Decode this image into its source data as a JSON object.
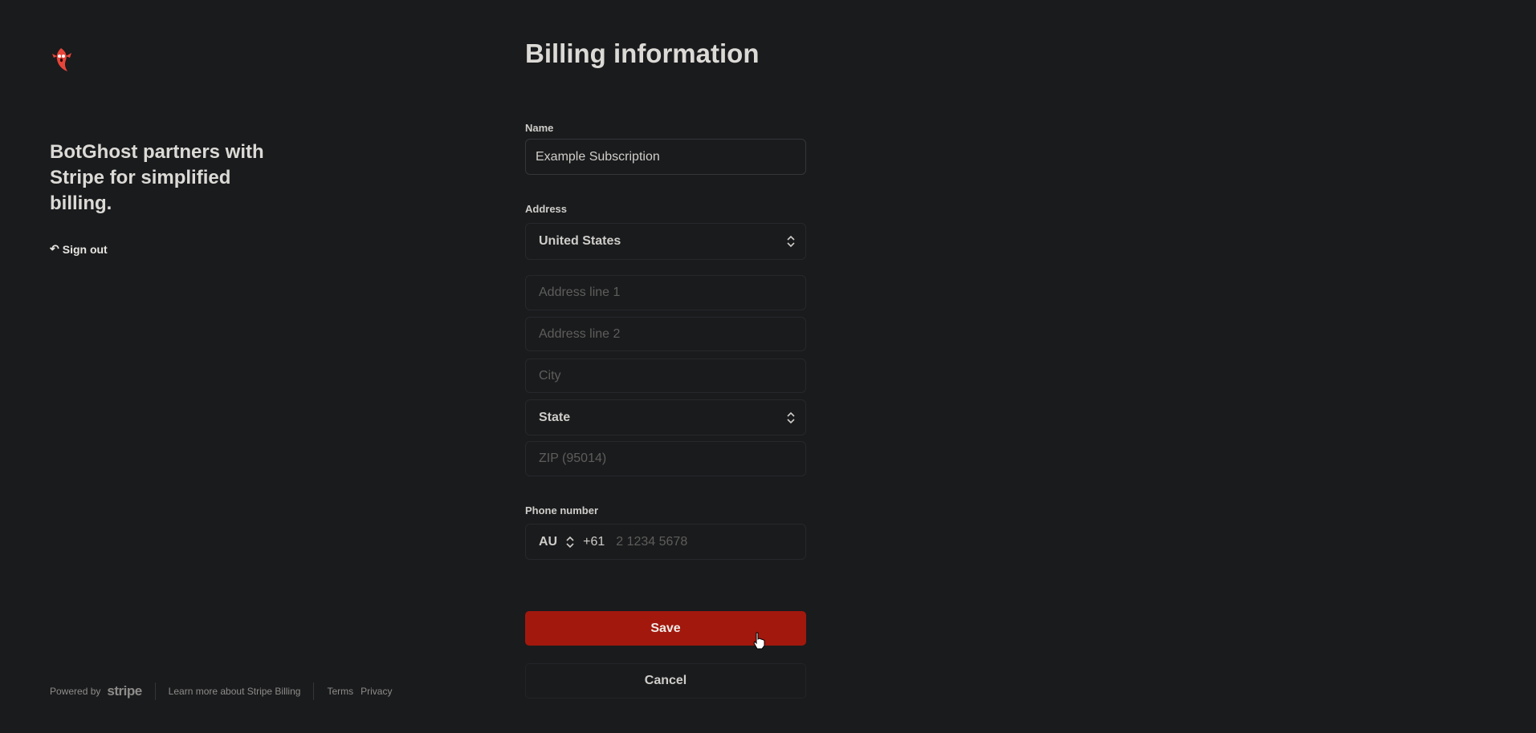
{
  "brand": {
    "headline": "BotGhost partners with Stripe for simplified billing.",
    "sign_out": "Sign out",
    "accent": "#a2180d"
  },
  "footer": {
    "powered_by": "Powered by",
    "stripe": "stripe",
    "learn_more": "Learn more about Stripe Billing",
    "terms": "Terms",
    "privacy": "Privacy"
  },
  "form": {
    "title": "Billing information",
    "name_label": "Name",
    "name_value": "Example Subscription",
    "address_label": "Address",
    "country": "United States",
    "address1_placeholder": "Address line 1",
    "address2_placeholder": "Address line 2",
    "city_placeholder": "City",
    "state": "State",
    "zip_placeholder": "ZIP (95014)",
    "phone_label": "Phone number",
    "phone_country": "AU",
    "phone_code": "+61",
    "phone_placeholder": "2 1234 5678",
    "save": "Save",
    "cancel": "Cancel"
  }
}
